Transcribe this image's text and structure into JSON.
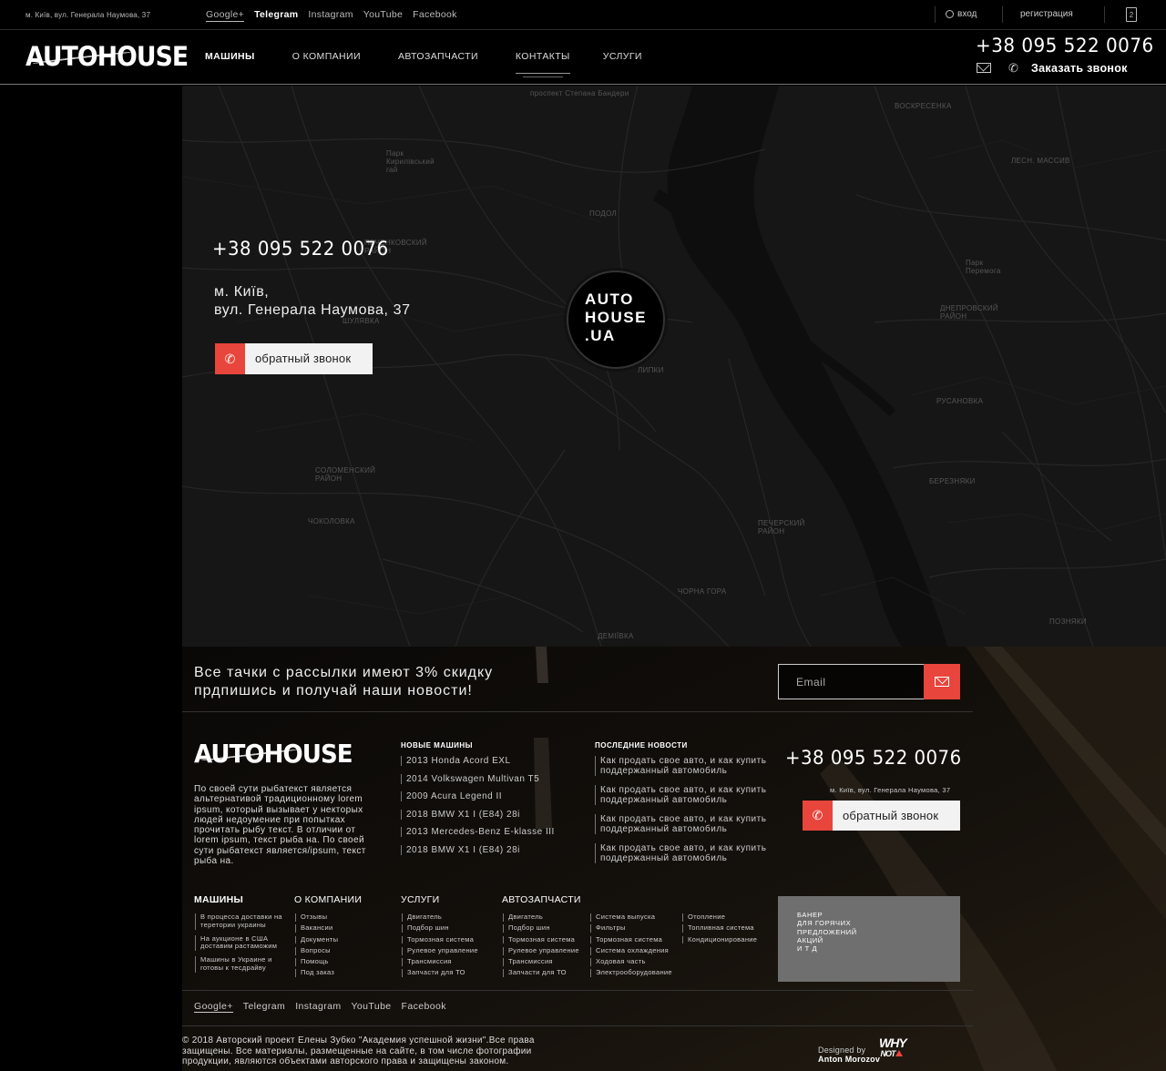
{
  "topbar": {
    "address": "м. Київ, вул. Генерала Наумова, 37",
    "socials": [
      "Google+",
      "Telegram",
      "Instagram",
      "YouTube",
      "Facebook"
    ],
    "login": "вход",
    "register": "регистрация",
    "cart_count": "2"
  },
  "header": {
    "logo": "AUTOHOUSE",
    "nav": [
      "МАШИНЫ",
      "О КОМПАНИИ",
      "АВТОЗАПЧАСТИ",
      "КОНТАКТЫ",
      "УСЛУГИ"
    ],
    "phone": "+38 095 522 0076",
    "callback": "Заказать звонок"
  },
  "map": {
    "phone": "+38 095 522 0076",
    "address_line1": "м. Київ,",
    "address_line2": "вул. Генерала Наумова, 37",
    "callback_button": "обратный звонок",
    "marker_line1": "AUTO",
    "marker_line2": "HOUSE",
    "marker_line3": ".UA",
    "labels": [
      {
        "text": "проспект Степана Бандери"
      },
      {
        "text": "ВОСКРЕСЕНКА"
      },
      {
        "text": "Парк\nКирилівський\nгай"
      },
      {
        "text": "ПОДОЛ"
      },
      {
        "text": "ЛЕСН. МАССИВ"
      },
      {
        "text": "ПЕЧЕНКОВСКИЙ\nРАЙОН"
      },
      {
        "text": "Парк\nПеремога"
      },
      {
        "text": "ДНЕПРОВСКИЙ\nРАЙОН"
      },
      {
        "text": "ЛИПКИ"
      },
      {
        "text": "РУСАНОВКА"
      },
      {
        "text": "ШУЛЯВКА"
      },
      {
        "text": "БЕРЕЗНЯКИ"
      },
      {
        "text": "СОЛОМЕНСКИЙ\nРАЙОН"
      },
      {
        "text": "ЧОКОЛОВКА"
      },
      {
        "text": "ПЕЧЕРСКИЙ\nРАЙОН"
      },
      {
        "text": "ЧОРНА ГОРА"
      },
      {
        "text": "ПОЗНЯКИ"
      },
      {
        "text": "ДЕМІЇВКА"
      }
    ]
  },
  "subscribe": {
    "line1": "Все тачки с рассылки имеют 3% скидку",
    "line2": "прдпишись и получай наши новости!",
    "email_placeholder": "Email"
  },
  "footer": {
    "logo": "AUTOHOUSE",
    "about": "По своей сути рыбатекст является альтернативой традиционному lorem ipsum, который вызывает у некторых людей недоумение при попытках прочитать рыбу текст. В отличии от lorem ipsum, текст рыба на. По своей сути рыбатекст является/ipsum, текст рыба на.",
    "new_cars_title": "НОВЫЕ МАШИНЫ",
    "new_cars": [
      "2013 Honda Acord EXL",
      "2014 Volkswagen Multivan T5",
      "2009 Acura Legend II",
      "2018 BMW X1 I (E84) 28i",
      "2013 Mercedes-Benz E-klasse III",
      "2018 BMW X1 I (E84) 28i"
    ],
    "news_title": "ПОСЛЕДНИЕ НОВОСТИ",
    "news": [
      "Как продать свое авто, и как купить поддержанный автомобиль",
      "Как продать свое авто, и как купить поддержанный автомобиль",
      "Как продать свое авто, и как купить поддержанный автомобиль",
      "Как продать свое авто, и как купить поддержанный автомобиль"
    ],
    "phone": "+38 095 522 0076",
    "address": "м. Київ, вул. Генерала Наумова, 37",
    "callback_button": "обратный звонок",
    "menus": {
      "cars": {
        "title": "МАШИНЫ",
        "items": [
          "В процесса доставки на теретории украины",
          "На аукционе в США доставим растаможим",
          "Машины в Украине и готовы к тесдрайву"
        ]
      },
      "company": {
        "title": "О КОМПАНИИ",
        "items": [
          "Отзывы",
          "Вакансии",
          "Документы",
          "Вопросы",
          "Помощь",
          "Под заказ"
        ]
      },
      "services": {
        "title": "УСЛУГИ",
        "items": [
          "Двигатель",
          "Подбор шин",
          "Тормозная система",
          "Рулевое управление",
          "Трансмиссия",
          "Запчасти для ТО"
        ]
      },
      "parts": {
        "title": "АВТОЗАПЧАСТИ",
        "col1": [
          "Двигатель",
          "Подбор шин",
          "Тормозная система",
          "Рулевое управление",
          "Трансмиссия",
          "Запчасти для ТО"
        ],
        "col2": [
          "Система выпуска",
          "Фильтры",
          "Тормозная система",
          "Система охлаждения",
          "Ходовая часть",
          "Электрооборудование"
        ],
        "col3": [
          "Отопление",
          "Топливная система",
          "Кондиционирование"
        ]
      }
    },
    "banner": "БАНЕР\nДЛЯ ГОРЯЧИХ\nПРЕДЛОЖЕНИЙ\nАКЦИЙ\nИ Т Д",
    "socials": [
      "Google+",
      "Telegram",
      "Instagram",
      "YouTube",
      "Facebook"
    ],
    "copyright": "© 2018 Авторский проект Елены Зубко \"Академия успешной жизни\".Все права защищены. Все материалы, размещенные на сайте, в том числе фотографии продукции, являются объектами авторского права и защищены законом.",
    "designed_by": "Designed by",
    "designer": "Anton Morozov",
    "studio_line1": "HY",
    "studio_line2": "NOT"
  },
  "colors": {
    "accent": "#e8453c",
    "background": "#000000",
    "map": "#161616"
  }
}
